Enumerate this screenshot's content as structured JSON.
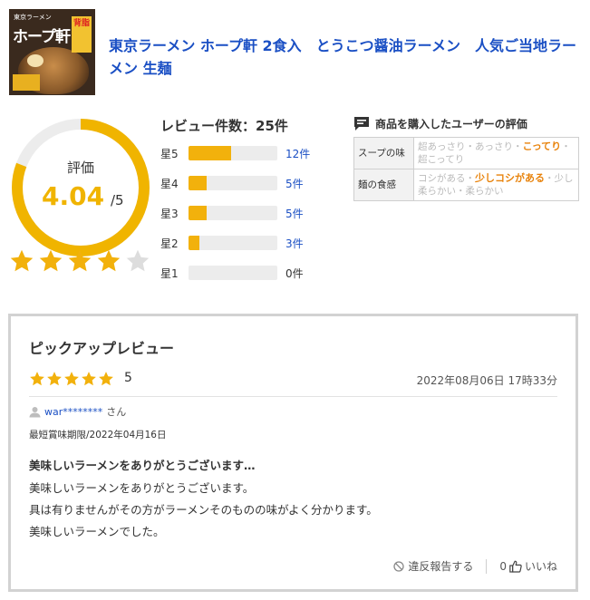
{
  "product": {
    "image_text_small": "東京ラーメン",
    "image_text_big": "ホープ軒",
    "image_badge": "背脂",
    "title": "東京ラーメン ホープ軒 2食入　とうこつ醤油ラーメン　人気ご当地ラーメン 生麺"
  },
  "rating": {
    "label": "評価",
    "score": "4.04",
    "of": "/5",
    "score_value": 4.04,
    "accent_color": "#f0b400",
    "track_color": "#ececec"
  },
  "distribution": {
    "title": "レビュー件数：25件",
    "rows": [
      {
        "label": "星5",
        "count": "12件",
        "fraction": 0.48
      },
      {
        "label": "星4",
        "count": "5件",
        "fraction": 0.2
      },
      {
        "label": "星3",
        "count": "5件",
        "fraction": 0.2
      },
      {
        "label": "星2",
        "count": "3件",
        "fraction": 0.12
      },
      {
        "label": "星1",
        "count": "0件",
        "fraction": 0
      }
    ]
  },
  "buyer_eval": {
    "title": "商品を購入したユーザーの評価",
    "icon": "speech-bubble-icon",
    "items": [
      {
        "key": "スープの味",
        "options_before": "超あっさり・あっさり・",
        "selected": "こってり",
        "options_after": "・超こってり"
      },
      {
        "key": "麺の食感",
        "options_before": "コシがある・",
        "selected": "少しコシがある",
        "options_after": "・少し柔らかい・柔らかい"
      }
    ]
  },
  "review": {
    "heading": "ピックアップレビュー",
    "stars": 5,
    "score": "5",
    "date": "2022年08月06日 17時33分",
    "user": "war********",
    "user_suffix": "さん",
    "best_by": "最短賞味期限/2022年04月16日",
    "title": "美味しいラーメンをありがとうございます…",
    "body": [
      "美味しいラーメンをありがとうございます。",
      "具は有りませんがその方がラーメンそのものの味がよく分かります。",
      "美味しいラーメンでした。"
    ],
    "report_label": "違反報告する",
    "like_count": "0",
    "like_label": "いいね"
  }
}
